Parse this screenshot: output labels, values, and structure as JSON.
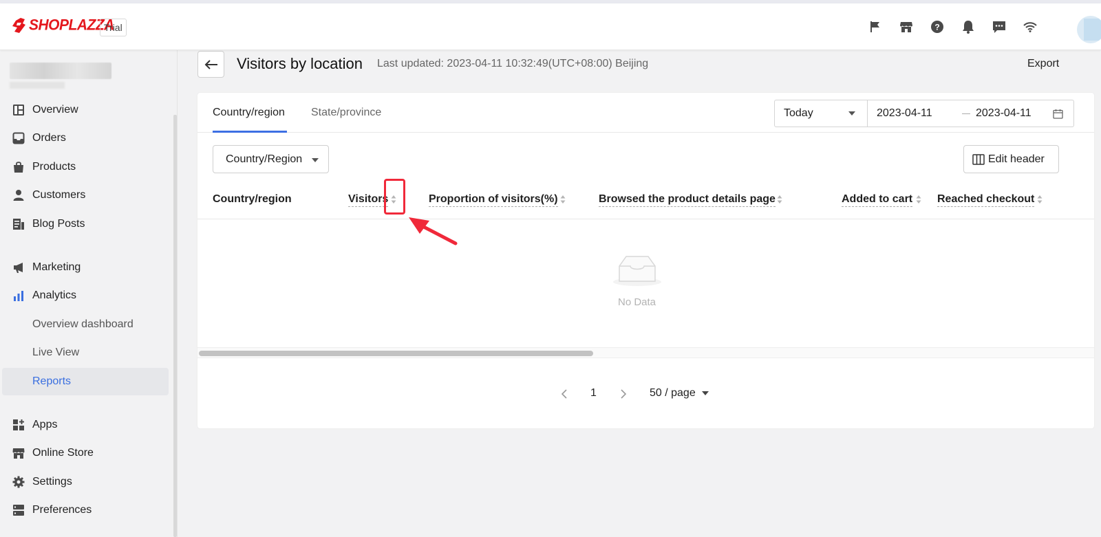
{
  "brand": {
    "name": "SHOPLAZZA",
    "badge": "Trial",
    "color": "#e4171d"
  },
  "topbar": {
    "icons": [
      "flag-icon",
      "store-icon",
      "help-icon",
      "bell-icon",
      "chat-icon",
      "wifi-icon"
    ]
  },
  "sidebar": {
    "items": [
      {
        "label": "Overview",
        "icon": "overview-icon"
      },
      {
        "label": "Orders",
        "icon": "orders-icon"
      },
      {
        "label": "Products",
        "icon": "products-icon"
      },
      {
        "label": "Customers",
        "icon": "customers-icon"
      },
      {
        "label": "Blog Posts",
        "icon": "blog-icon"
      },
      {
        "label": "Marketing",
        "icon": "megaphone-icon"
      },
      {
        "label": "Analytics",
        "icon": "analytics-icon"
      },
      {
        "label": "Apps",
        "icon": "apps-icon"
      },
      {
        "label": "Online Store",
        "icon": "online-store-icon"
      },
      {
        "label": "Settings",
        "icon": "gear-icon"
      },
      {
        "label": "Preferences",
        "icon": "preferences-icon"
      }
    ],
    "analytics_sub": [
      {
        "label": "Overview dashboard"
      },
      {
        "label": "Live View"
      },
      {
        "label": "Reports",
        "active": true
      }
    ],
    "accent": "#3a6fe0"
  },
  "header": {
    "title": "Visitors by location",
    "last_updated": "Last updated: 2023-04-11 10:32:49(UTC+08:00) Beijing",
    "export": "Export"
  },
  "tabs": [
    {
      "label": "Country/region",
      "active": true
    },
    {
      "label": "State/province",
      "active": false
    }
  ],
  "date_filter": {
    "range": "Today",
    "from": "2023-04-11",
    "to": "2023-04-11"
  },
  "filter": {
    "label": "Country/Region"
  },
  "edit_header": {
    "label": "Edit header"
  },
  "table": {
    "columns": [
      {
        "label": "Country/region",
        "sortable": false
      },
      {
        "label": "Visitors",
        "sortable": true
      },
      {
        "label": "Proportion of visitors(%)",
        "sortable": true
      },
      {
        "label": "Browsed the product details page",
        "sortable": true
      },
      {
        "label": "Added to cart",
        "sortable": true
      },
      {
        "label": "Reached checkout",
        "sortable": true
      }
    ],
    "empty_text": "No Data"
  },
  "pagination": {
    "current_page": "1",
    "page_size": "50 / page"
  },
  "annotation": {
    "highlight_color": "#f0293a"
  }
}
